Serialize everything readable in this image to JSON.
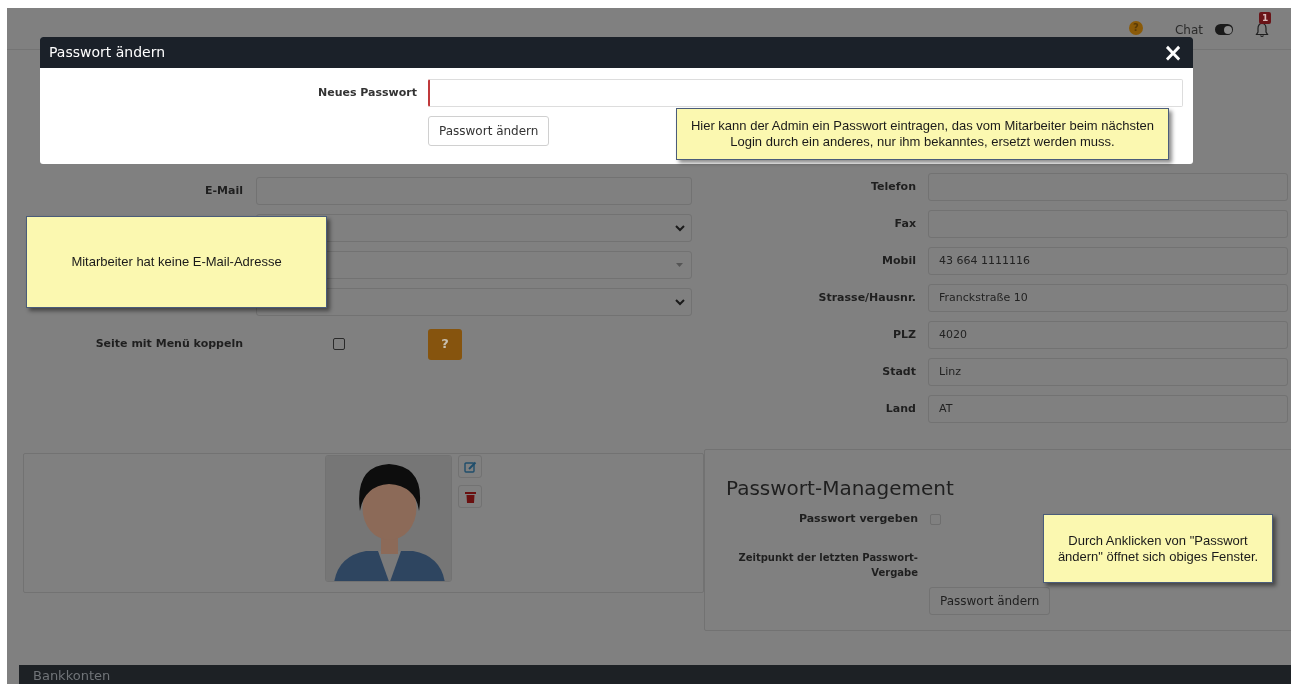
{
  "header": {
    "help_icon": "?",
    "chat_label": "Chat",
    "chat_on": true,
    "notification_count": "1"
  },
  "left_form": {
    "fields": [
      {
        "kind": "text",
        "label": "E-Mail"
      },
      {
        "kind": "select"
      },
      {
        "kind": "combo"
      },
      {
        "kind": "select"
      },
      {
        "kind": "checkbox",
        "label": "Seite mit Menü koppeln",
        "checked": false,
        "help": "?"
      }
    ]
  },
  "contact": {
    "fields": [
      {
        "label": "Telefon"
      },
      {
        "label": "Fax"
      },
      {
        "label": "Mobil",
        "value": "43 664 1111116"
      },
      {
        "label": "Strasse/Hausnr.",
        "value": "Franckstraße 10"
      },
      {
        "label": "PLZ",
        "value": "4020"
      },
      {
        "label": "Stadt",
        "value": "Linz"
      },
      {
        "label": "Land",
        "value": "AT"
      }
    ]
  },
  "password_management": {
    "title": "Passwort-Management",
    "assigned_label": "Passwort vergeben",
    "assigned_checked": false,
    "last_label": "Zeitpunkt der letzten Passwort-Vergabe",
    "button": "Passwort ändern"
  },
  "bottom_bar": {
    "title": "Bankkonten"
  },
  "modal": {
    "title": "Passwort ändern",
    "close": "×",
    "field_label": "Neues Passwort",
    "button": "Passwort ändern"
  },
  "callouts": [
    {
      "text": "Hier kann der Admin ein Passwort eintragen, das vom Mitarbeiter beim nächsten Login durch ein anderes, nur ihm bekanntes, ersetzt werden muss."
    },
    {
      "text": "Mitarbeiter hat keine E-Mail-Adresse"
    },
    {
      "text": "Durch Anklicken von \"Passwort ändern\" öffnet sich obiges Fenster."
    }
  ]
}
